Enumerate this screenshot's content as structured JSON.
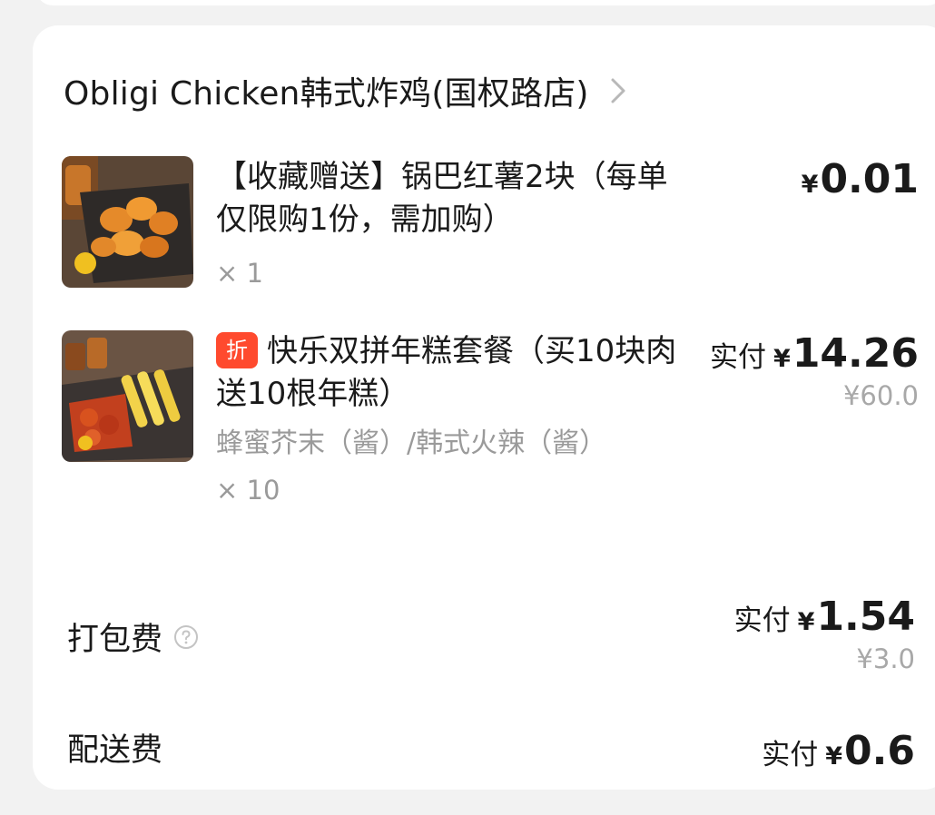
{
  "store": {
    "name": "Obligi Chicken韩式炸鸡(国权路店)"
  },
  "items": [
    {
      "title": "【收藏赠送】锅巴红薯2块（每单仅限购1份，需加购）",
      "quantity": "× 1",
      "price_symbol": "¥",
      "price": "0.01"
    },
    {
      "tag": "折",
      "title": "快乐双拼年糕套餐（买10块肉送10根年糕）",
      "spec": "蜂蜜芥末（酱）/韩式火辣（酱）",
      "quantity": "× 10",
      "paid_label": "实付",
      "price_symbol": "¥",
      "price": "14.26",
      "original_price": "¥60.0"
    }
  ],
  "fees": {
    "packaging": {
      "label": "打包费",
      "paid_label": "实付",
      "price_symbol": "¥",
      "price": "1.54",
      "original_price": "¥3.0"
    },
    "delivery": {
      "label": "配送费",
      "paid_label": "实付",
      "price_symbol": "¥",
      "price": "0.6"
    }
  },
  "colors": {
    "discount_tag": "#ff4a2e",
    "secondary_text": "#9a9a9a"
  }
}
